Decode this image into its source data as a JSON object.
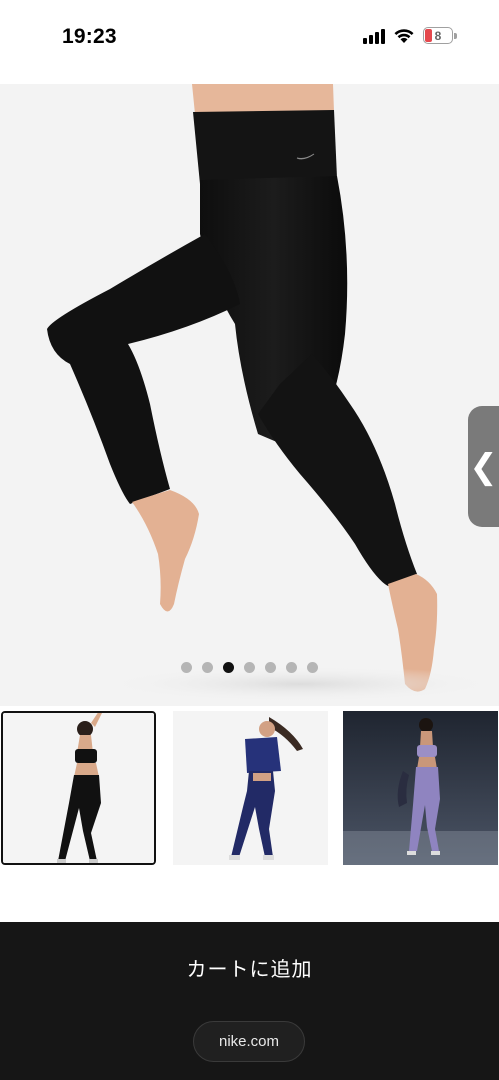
{
  "status_bar": {
    "time": "19:23",
    "battery_level": "8",
    "icons": [
      "cellular-signal-icon",
      "wifi-icon",
      "battery-icon"
    ]
  },
  "product_gallery": {
    "image_description": "black high-rise leggings",
    "side_handle_glyph": "❮",
    "pagination": {
      "total": 7,
      "active_index": 2
    },
    "thumbnails": [
      {
        "subject": "black sports bra and black leggings",
        "selected": true
      },
      {
        "subject": "navy top and navy leggings",
        "selected": false
      },
      {
        "subject": "lavender sports bra and lavender leggings",
        "selected": false
      }
    ]
  },
  "bottom_bar": {
    "cart_button_label": "カートに追加",
    "url_label": "nike.com"
  },
  "colors": {
    "hero_background": "#f3f3f3",
    "bottom_bar": "#161616",
    "active_dot": "#111111",
    "inactive_dot": "#b5b5b5",
    "battery_low": "#e5484d"
  }
}
